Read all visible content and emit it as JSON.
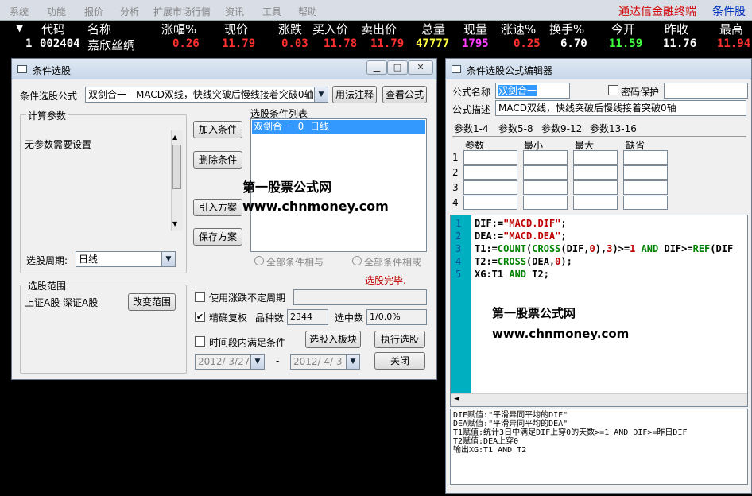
{
  "menu": [
    "系统",
    "功能",
    "报价",
    "分析",
    "扩展市场行情",
    "资讯",
    "工具",
    "帮助"
  ],
  "brand": "通达信金融终端",
  "brand_tab": "条件股",
  "quote_header": {
    "marker": "▼",
    "cols": [
      "代码",
      "名称",
      "涨幅%",
      "现价",
      "涨跌",
      "买入价",
      "卖出价",
      "总量",
      "现量",
      "涨速%",
      "换手%",
      "今开",
      "昨收",
      "最高"
    ]
  },
  "quote_row": {
    "index": "1",
    "code": "002404",
    "name": "嘉欣丝绸",
    "change_pct": "0.26",
    "price": "11.79",
    "change": "0.03",
    "bid": "11.78",
    "ask": "11.79",
    "volume": "47777",
    "cur_vol": "1795",
    "speed": "0.25",
    "turnover": "6.70",
    "open": "11.59",
    "prev_close": "11.76",
    "high": "11.94"
  },
  "colors": {
    "up": "#ff3030",
    "volume": "#ffff40",
    "cur_vol": "#ff40ff",
    "open": "#40ff40",
    "white": "#ffffff",
    "selection": "#3399ff"
  },
  "selector": {
    "title": "条件选股",
    "formula_label": "条件选股公式",
    "formula_value": "双剑合一  - MACD双线，快线突破后慢线接着突破0轴",
    "usage_button": "用法注释",
    "view_button": "查看公式",
    "params_group": "计算参数",
    "params_text": "无参数需要设置",
    "period_label": "选股周期:",
    "period_value": "日线",
    "add_button": "加入条件",
    "delete_button": "删除条件",
    "import_button": "引入方案",
    "save_button": "保存方案",
    "list_label": "选股条件列表",
    "list_item": "双剑合一  0  日线",
    "radio_and": "全部条件相与",
    "radio_or": "全部条件相或",
    "status": "选股完毕.",
    "range_group": "选股范围",
    "range_text": "上证A股  深证A股",
    "change_range_button": "改变范围",
    "chk_uncertain": "使用涨跌不定周期",
    "chk_precise": "精确复权",
    "variety_label": "品种数",
    "variety_value": "2344",
    "selected_label": "选中数",
    "selected_value": "1/0.0%",
    "chk_period": "时间段内满足条件",
    "to_block_button": "选股入板块",
    "run_button": "执行选股",
    "date_from": "2012/ 3/27",
    "date_sep": "-",
    "date_to": "2012/ 4/ 3",
    "close_button": "关闭"
  },
  "editor": {
    "title": "条件选股公式编辑器",
    "name_label": "公式名称",
    "name_value": "双剑合一",
    "pwd_label": "密码保护",
    "desc_label": "公式描述",
    "desc_value": "MACD双线，快线突破后慢线接着突破0轴",
    "tabs": [
      "参数1-4",
      "参数5-8",
      "参数9-12",
      "参数13-16"
    ],
    "grid_headers": [
      "参数",
      "最小",
      "最大",
      "缺省"
    ],
    "row_numbers": [
      "1",
      "2",
      "3",
      "4"
    ],
    "line_numbers": [
      "1",
      "2",
      "3",
      "4",
      "5"
    ],
    "notes": "DIF赋值:\"平滑异同平均的DIF\"\nDEA赋值:\"平滑异同平均的DEA\"\nT1赋值:统计3日中满足DIF上穿0的天数>=1 AND DIF>=昨日DIF\nT2赋值:DEA上穿0\n输出XG:T1 AND T2"
  },
  "code": {
    "l1a": "DIF:=",
    "l1b": "\"MACD.DIF\"",
    "l1c": ";",
    "l2a": "DEA:=",
    "l2b": "\"MACD.DEA\"",
    "l2c": ";",
    "l3a": "T1:=",
    "l3b": "COUNT",
    "l3c": "(",
    "l3d": "CROSS",
    "l3e": "(DIF,",
    "l3f": "0",
    "l3g": "),",
    "l3h": "3",
    "l3i": ")>=",
    "l3j": "1",
    "l3k": " AND ",
    "l3l": "DIF>=",
    "l3m": "REF",
    "l3n": "(DIF",
    "l4a": "T2:=",
    "l4b": "CROSS",
    "l4c": "(DEA,",
    "l4d": "0",
    "l4e": ");",
    "l5a": "XG:T1 ",
    "l5b": "AND",
    "l5c": " T2;"
  },
  "watermark": {
    "cn": "第一股票公式网",
    "url": "www.chnmoney.com"
  }
}
